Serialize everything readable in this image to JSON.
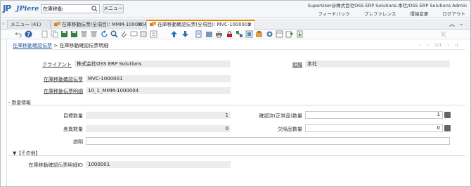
{
  "header": {
    "logo_mark": "JP",
    "logo_text": "JPiere",
    "search_value": "在庫移動",
    "menu_label": "メニュー",
    "user_info": "SuperUser@株式会社OSS ERP Solutions.本社/OSS ERP Solutions Admin",
    "links": [
      "フィードバック",
      "プレファレンス",
      "環境変更",
      "ログアウト"
    ]
  },
  "tabs": [
    {
      "label": "メニュー (41)"
    },
    {
      "label": "在庫移動伝票(全項目): MMM-1000004"
    },
    {
      "label": "在庫移動確認伝票(全項目): MVC-1000001"
    }
  ],
  "breadcrumb": {
    "link": "在庫移動確認伝票",
    "separator": ">",
    "current": "在庫移動確認伝票明細"
  },
  "pager": "1/1",
  "form": {
    "client_label": "クライアント",
    "client_value": "株式会社OSS ERP Solutions",
    "org_label": "組織",
    "org_value": "本社",
    "confirm_label": "在庫移動確認伝票",
    "confirm_value": "MVC-1000001",
    "line_label": "在庫移動伝票明細",
    "line_value": "10_1_MMM-1000004"
  },
  "qty_section": {
    "title": "- 数量情報",
    "target_label": "目標数量",
    "target_value": "1",
    "confirmed_label": "確認済(正常品)数量",
    "confirmed_value": "1",
    "diff_label": "差異数量",
    "diff_value": "0",
    "scrap_label": "欠陥品数量",
    "scrap_value": "0",
    "desc_label": "説明",
    "desc_value": ""
  },
  "other_section": {
    "title": "▼【その他】",
    "id_label": "在庫移動確認伝票明細ID",
    "id_value": "1000001"
  },
  "colors": {
    "accent": "#e58a00",
    "brand": "#2a67b3",
    "link": "#2a5fa8"
  }
}
